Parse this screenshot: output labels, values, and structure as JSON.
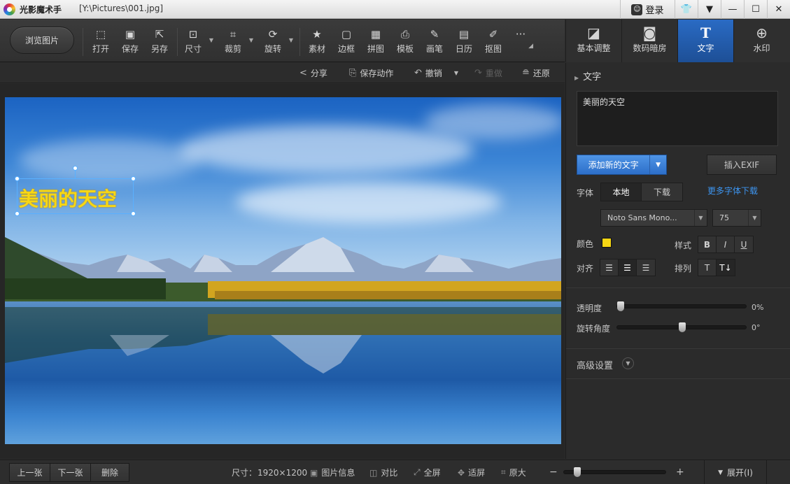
{
  "window": {
    "app_name": "光影魔术手",
    "file_path": "[Y:\\Pictures\\001.jpg]",
    "login_label": "登录"
  },
  "toolbar": {
    "browse_label": "浏览图片",
    "tools": [
      {
        "label": "打开",
        "icon": "open-icon"
      },
      {
        "label": "保存",
        "icon": "save-icon"
      },
      {
        "label": "另存",
        "icon": "save-as-icon"
      },
      {
        "label": "尺寸",
        "icon": "resize-icon"
      },
      {
        "label": "裁剪",
        "icon": "crop-icon"
      },
      {
        "label": "旋转",
        "icon": "rotate-icon"
      },
      {
        "label": "素材",
        "icon": "material-icon"
      },
      {
        "label": "边框",
        "icon": "border-icon"
      },
      {
        "label": "拼图",
        "icon": "collage-icon"
      },
      {
        "label": "模板",
        "icon": "template-icon"
      },
      {
        "label": "画笔",
        "icon": "brush-icon"
      },
      {
        "label": "日历",
        "icon": "calendar-icon"
      },
      {
        "label": "抠图",
        "icon": "cutout-icon"
      }
    ]
  },
  "right_tabs": [
    {
      "label": "基本调整",
      "icon": "adjust-icon"
    },
    {
      "label": "数码暗房",
      "icon": "camera-icon"
    },
    {
      "label": "文字",
      "icon": "text-icon"
    },
    {
      "label": "水印",
      "icon": "watermark-icon"
    }
  ],
  "actions": {
    "share": "分享",
    "save_action": "保存动作",
    "undo": "撤销",
    "redo": "重做",
    "restore": "还原"
  },
  "canvas": {
    "overlay_text": "美丽的天空"
  },
  "text_panel": {
    "section_title": "文字",
    "text_value": "美丽的天空",
    "add_text_label": "添加新的文字",
    "insert_exif_label": "插入EXIF",
    "font_label": "字体",
    "font_local": "本地",
    "font_download": "下载",
    "more_fonts_link": "更多字体下载",
    "font_name": "Noto Sans Mono...",
    "font_size": "75",
    "color_label": "颜色",
    "text_color": "#f7d714",
    "style_label": "样式",
    "style_bold": "B",
    "style_italic": "I",
    "style_underline": "U",
    "align_label": "对齐",
    "arrange_label": "排列",
    "opacity_label": "透明度",
    "opacity_value": "0%",
    "rotation_label": "旋转角度",
    "rotation_value": "0°",
    "advanced_label": "高级设置"
  },
  "bottom": {
    "prev": "上一张",
    "next": "下一张",
    "delete": "删除",
    "size_label": "尺寸：",
    "size_value": "1920×1200",
    "info": "图片信息",
    "compare": "对比",
    "fullscreen": "全屏",
    "fit": "适屏",
    "original": "原大",
    "expand": "展开(I)"
  },
  "colors": {
    "accent": "#2d6fc9",
    "link": "#3d95f0"
  }
}
